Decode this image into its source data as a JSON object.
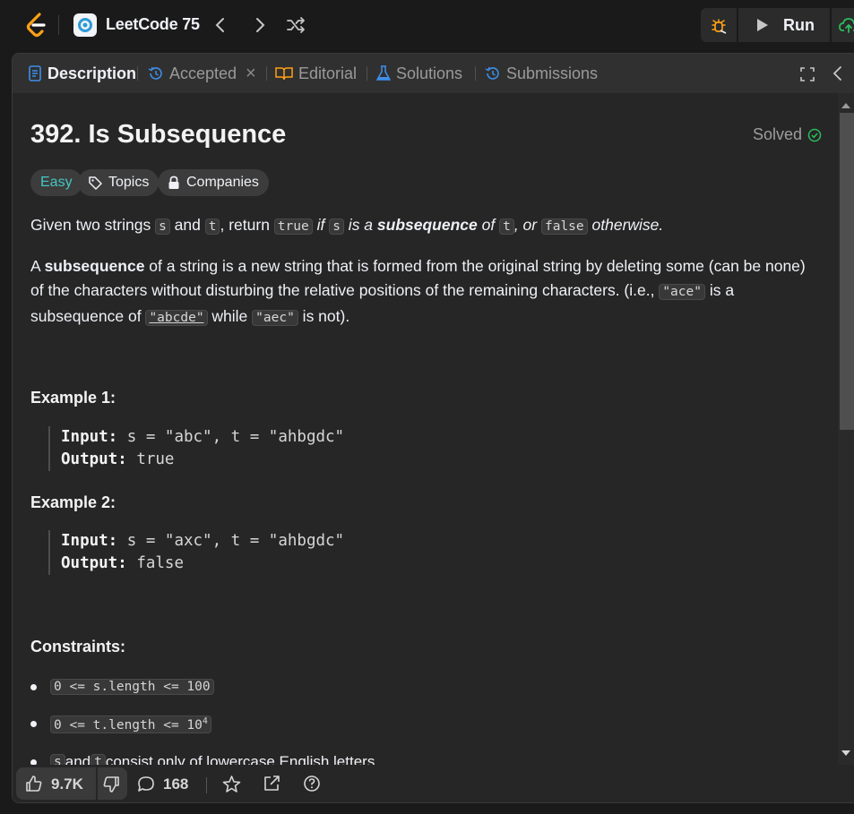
{
  "topbar": {
    "list_title": "LeetCode 75",
    "run_label": "Run",
    "colors": {
      "logo_orange": "#ffa116",
      "accent_green": "#2cbb5d"
    }
  },
  "tabs": [
    {
      "label": "Description",
      "icon": "description-icon",
      "active": true
    },
    {
      "label": "Accepted",
      "icon": "history-icon",
      "active": false
    },
    {
      "label": "Editorial",
      "icon": "book-icon",
      "active": false
    },
    {
      "label": "Solutions",
      "icon": "flask-icon",
      "active": false
    },
    {
      "label": "Submissions",
      "icon": "history-icon",
      "active": false
    }
  ],
  "problem": {
    "title": "392. Is Subsequence",
    "status": "Solved",
    "difficulty": "Easy",
    "topics_label": "Topics",
    "companies_label": "Companies",
    "p1": {
      "t1": "Given two strings ",
      "c1": "s",
      "t2": " and ",
      "c2": "t",
      "t3": ", return ",
      "c3": "true",
      "t4": " if ",
      "c4": "s",
      "t5": " is a ",
      "b1": "subsequence",
      "t6": " of ",
      "c5": "t",
      "t7": ", or ",
      "c6": "false",
      "t8": " otherwise."
    },
    "p2": {
      "t1": "A ",
      "b1": "subsequence",
      "t2": " of a string is a new string that is formed from the original string by deleting some (can be none) of the characters without disturbing the relative positions of the remaining characters. (i.e., ",
      "c1": "\"ace\"",
      "t3": " is a subsequence of ",
      "c2": "\"abcde\"",
      "t4": " while ",
      "c3": "\"aec\"",
      "t5": " is not)."
    },
    "examples": [
      {
        "heading": "Example 1:",
        "input_label": "Input:",
        "input": "s = \"abc\", t = \"ahbgdc\"",
        "output_label": "Output:",
        "output": "true"
      },
      {
        "heading": "Example 2:",
        "input_label": "Input:",
        "input": "s = \"axc\", t = \"ahbgdc\"",
        "output_label": "Output:",
        "output": "false"
      }
    ],
    "constraints_heading": "Constraints:",
    "constraints": {
      "c1": "0 <= s.length <= 100",
      "c2_base": "0 <= t.length <= 10",
      "c2_sup": "4",
      "c3_code1": "s",
      "c3_mid": " and ",
      "c3_code2": "t",
      "c3_tail": " consist only of lowercase English letters."
    }
  },
  "bottombar": {
    "likes": "9.7K",
    "comments": "168"
  }
}
